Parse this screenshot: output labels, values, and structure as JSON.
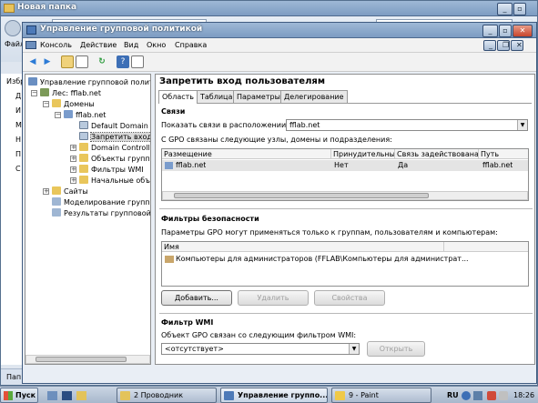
{
  "bg_window": {
    "title": "Новая папка",
    "address_partial": "Новая папка",
    "menu_partial": "Файл",
    "left_items": [
      "Избр",
      "Д",
      "И",
      "М",
      "Н",
      "П",
      "С"
    ],
    "status_partial": "Пап"
  },
  "window": {
    "title": "Управление групповой политикой"
  },
  "menu": [
    "Консоль",
    "Действие",
    "Вид",
    "Окно",
    "Справка"
  ],
  "tree": {
    "root": "Управление групповой политикой",
    "forest": "Лес: fflab.net",
    "domains": "Домены",
    "domain": "fflab.net",
    "gpo_default": "Default Domain Policy",
    "gpo_selected": "Запретить вход пользователям",
    "dc": "Domain Controllers",
    "objects": "Объекты групповой политики",
    "wmi": "Фильтры WMI",
    "starter": "Начальные объекты групповой политики",
    "sites": "Сайты",
    "modeling": "Моделирование групповой политики",
    "results": "Результаты групповой политики"
  },
  "detail": {
    "title": "Запретить вход пользователям",
    "tabs": [
      "Область",
      "Таблица",
      "Параметры",
      "Делегирование"
    ],
    "links": {
      "header": "Связи",
      "show_label": "Показать связи в расположении:",
      "location": "fflab.net",
      "desc": "С GPO связаны следующие узлы, домены и подразделения:",
      "columns": [
        "Размещение",
        "Принудительный",
        "Связь задействована",
        "Путь"
      ],
      "rows": [
        {
          "location": "fflab.net",
          "enforced": "Нет",
          "enabled": "Да",
          "path": "fflab.net"
        }
      ]
    },
    "security": {
      "header": "Фильтры безопасности",
      "desc": "Параметры GPO могут применяться только к группам, пользователям и компьютерам:",
      "column": "Имя",
      "rows": [
        "Компьютеры для администраторов (FFLAB\\Компьютеры для администрат..."
      ],
      "buttons": {
        "add": "Добавить...",
        "remove": "Удалить",
        "properties": "Свойства"
      }
    },
    "wmi": {
      "header": "Фильтр WMI",
      "desc": "Объект GPO связан со следующим фильтром WMI:",
      "value": "<отсутствует>",
      "open": "Открыть"
    }
  },
  "taskbar": {
    "start": "Пуск",
    "buttons": [
      "2 Проводник",
      "Управление группо...",
      "9 - Paint"
    ],
    "lang": "RU",
    "clock": "18:26"
  },
  "colors": {
    "desktop": "#6b7f96",
    "titlebar": "#8facd0",
    "taskbar": "#b7c6d9"
  }
}
